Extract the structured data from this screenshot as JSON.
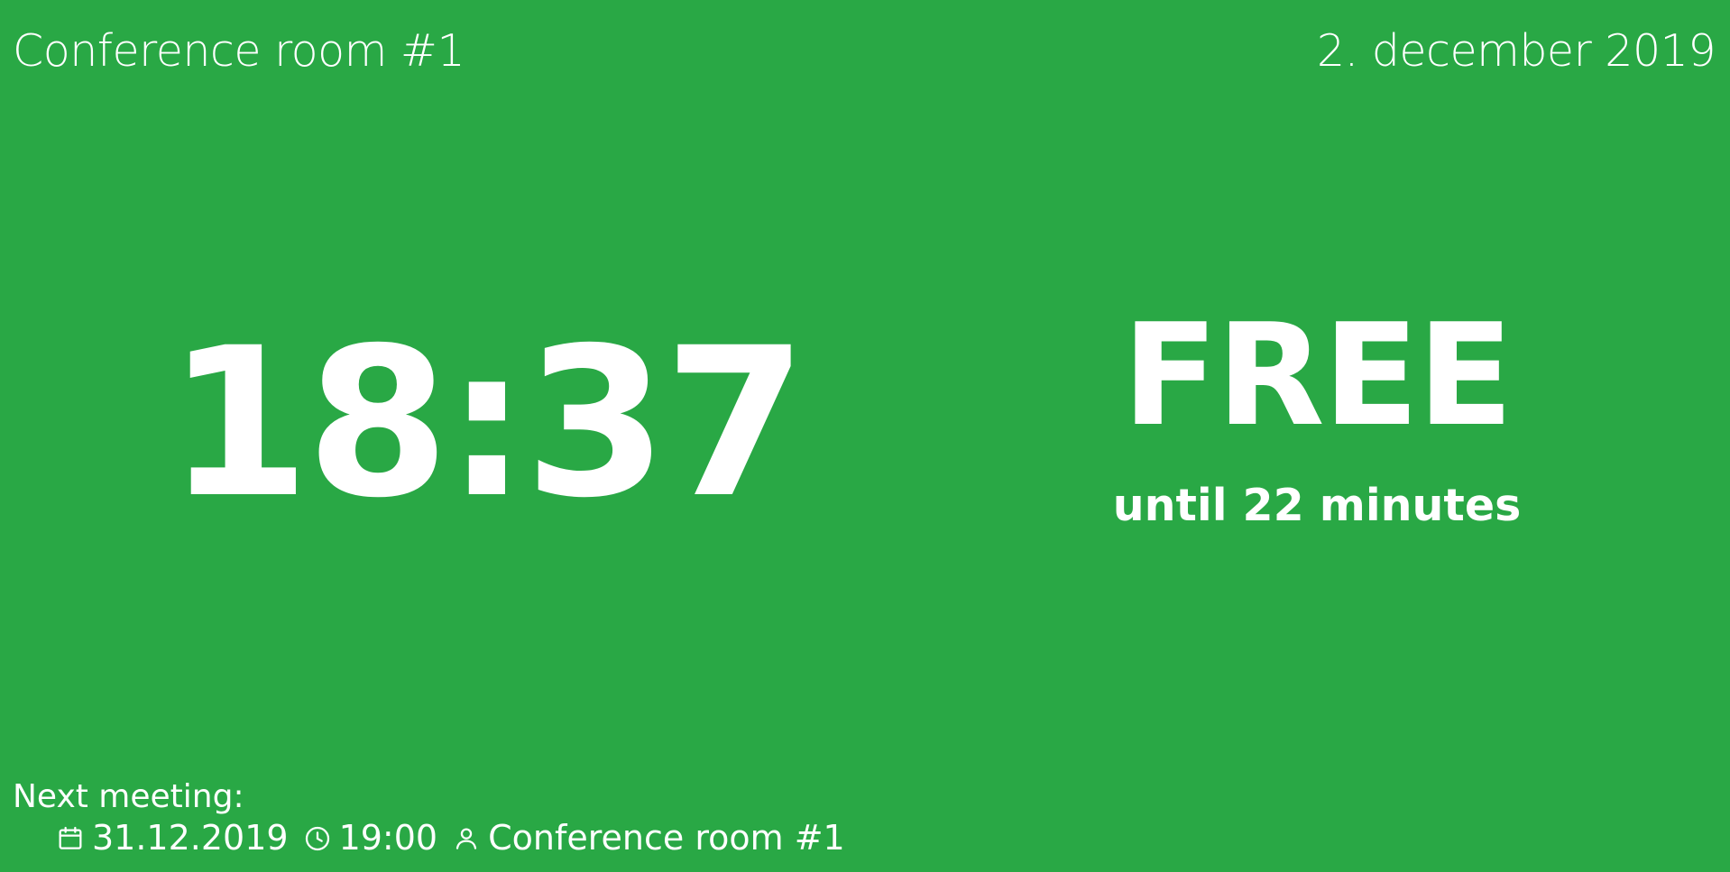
{
  "header": {
    "room_name": "Conference room #1",
    "date": "2. december 2019"
  },
  "clock": {
    "time": "18:37"
  },
  "status": {
    "label": "FREE",
    "subtitle": "until 22 minutes",
    "color": "#29a845"
  },
  "next_meeting": {
    "label": "Next meeting:",
    "date": "31.12.2019",
    "time": "19:00",
    "room": "Conference room #1",
    "icons": {
      "date": "calendar-icon",
      "time": "clock-icon",
      "room": "person-icon"
    }
  }
}
